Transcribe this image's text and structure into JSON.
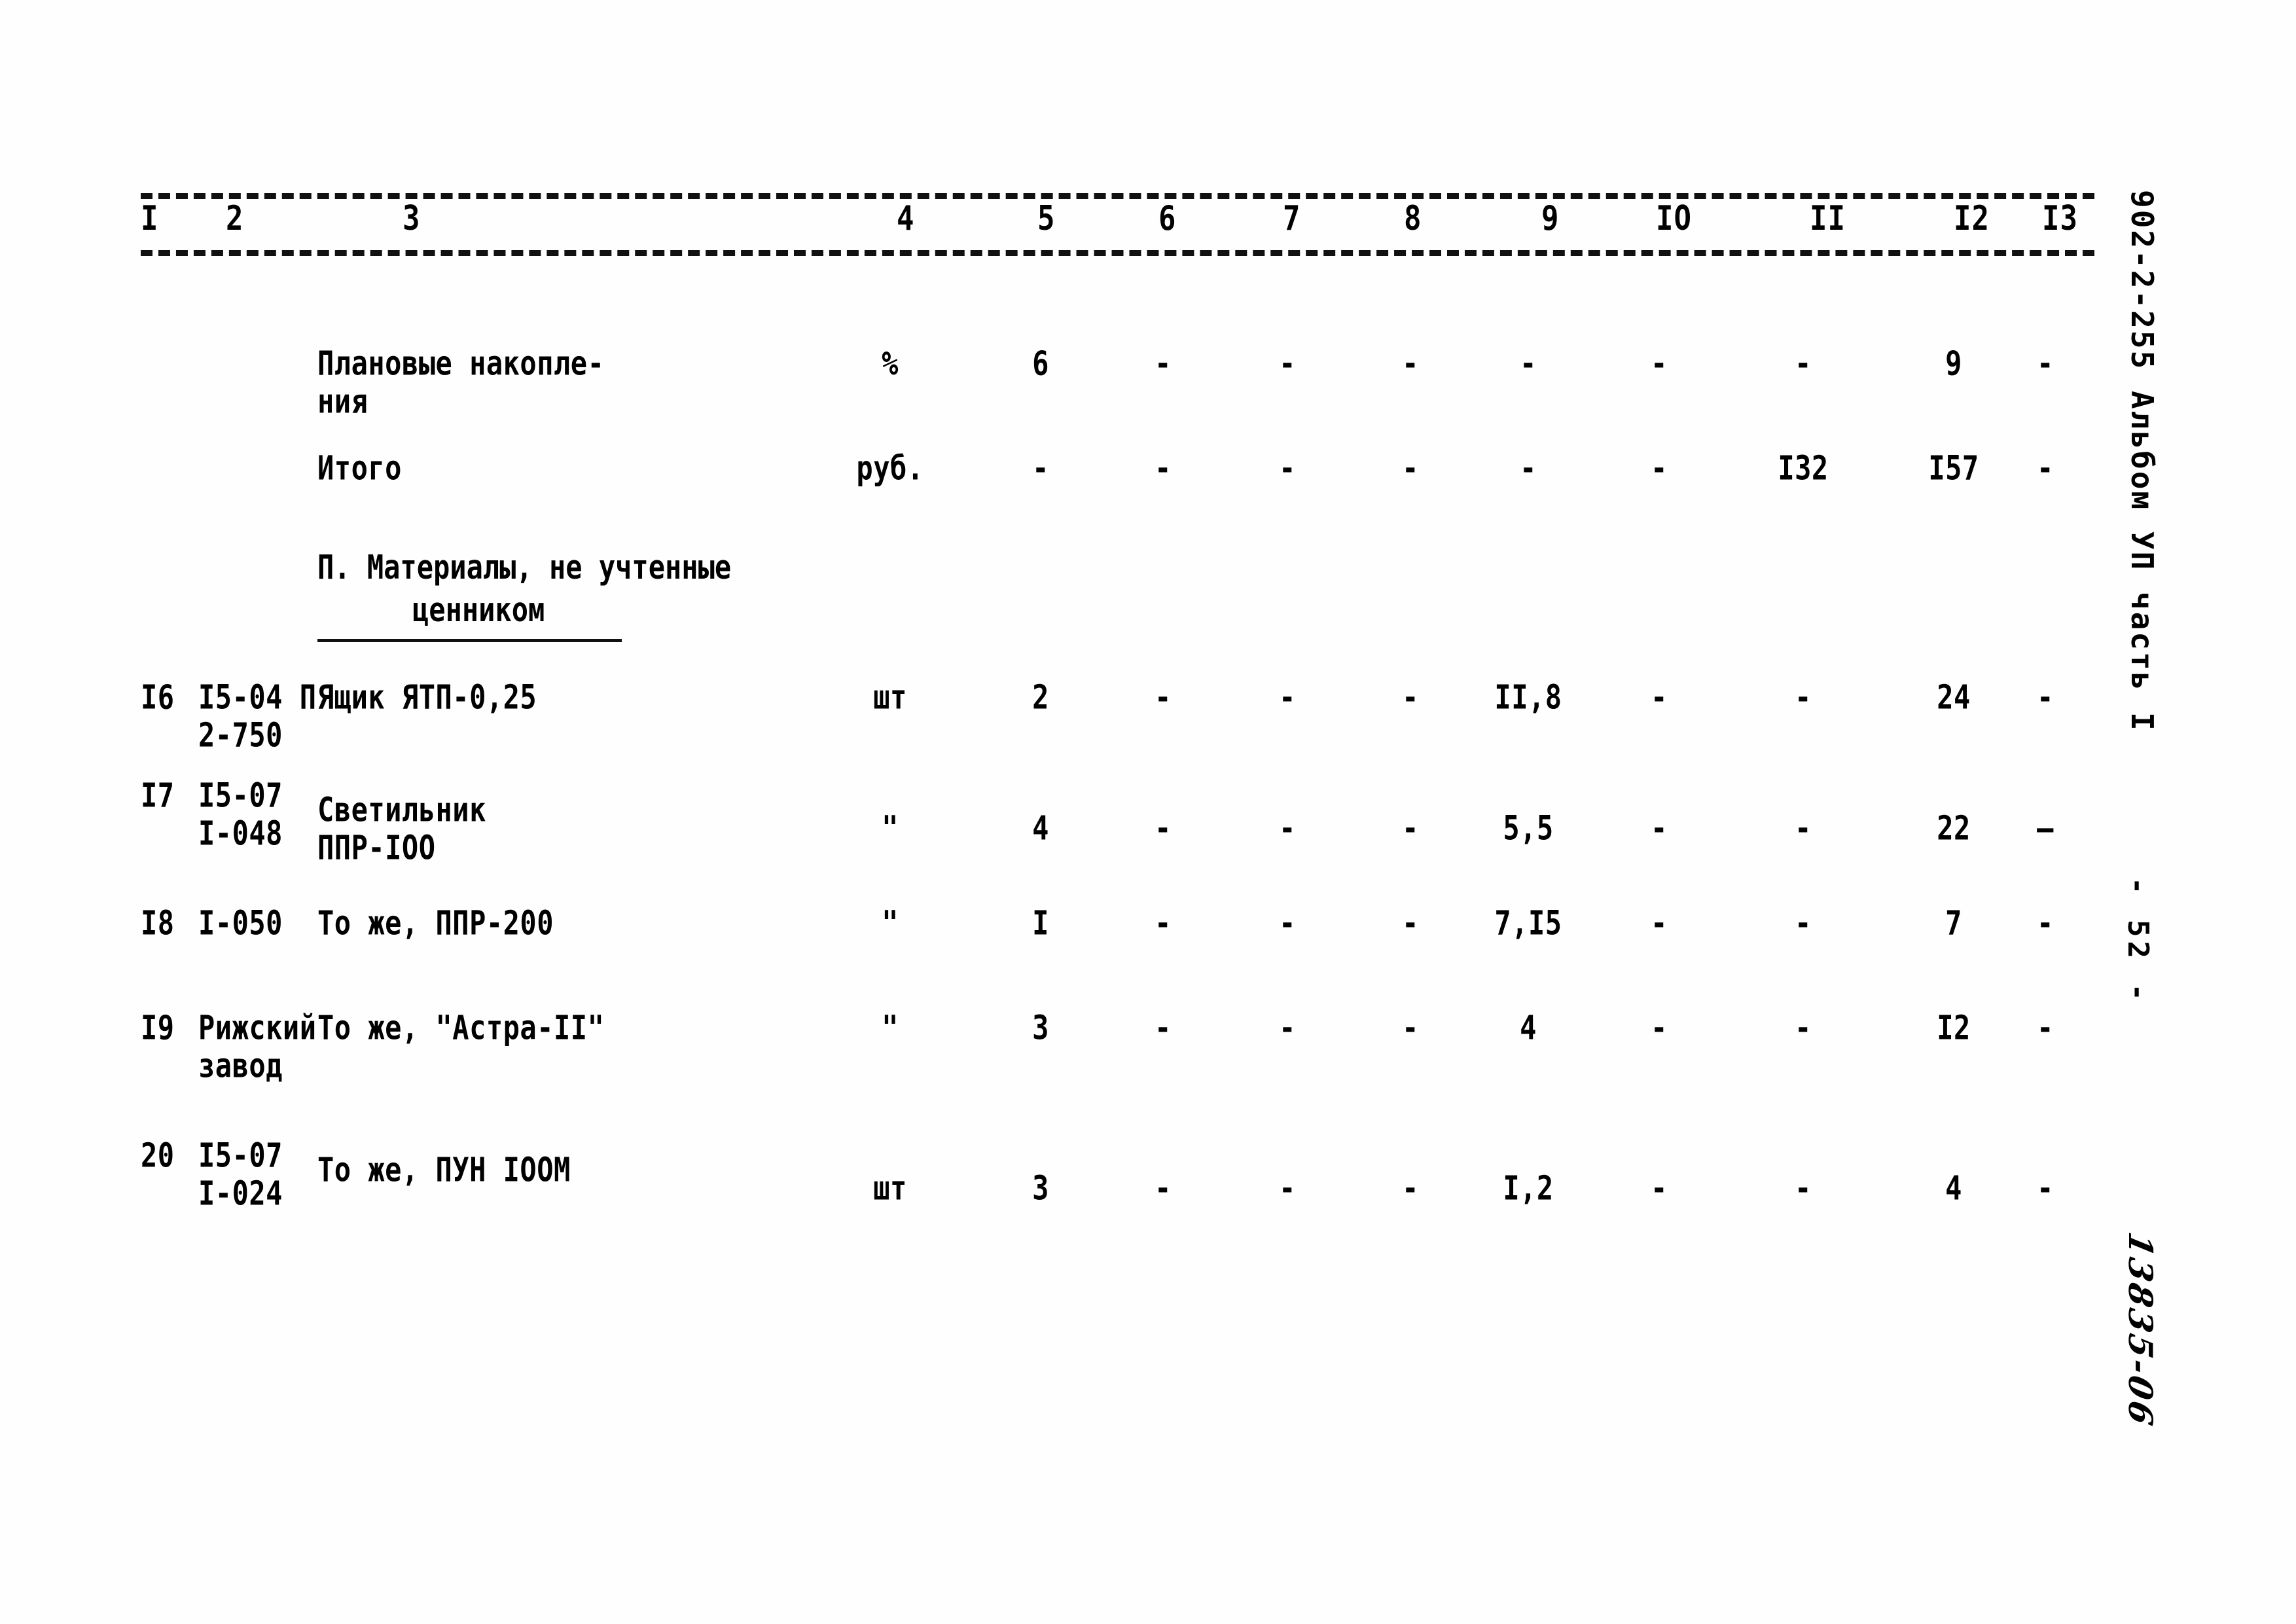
{
  "document": {
    "album_reference": "902-2-255 Альбом УП часть I",
    "page_number": "- 52 -",
    "stamp": "13835-06"
  },
  "table": {
    "column_numbers": [
      "I",
      "2",
      "3",
      "4",
      "5",
      "6",
      "7",
      "8",
      "9",
      "IO",
      "II",
      "I2",
      "I3"
    ],
    "section_heading": {
      "line1": "П. Материалы, не учтенные",
      "line2": "ценником"
    },
    "rows": [
      {
        "no": "",
        "code_line1": "",
        "code_line2": "",
        "name_line1": "Плановые накопле-",
        "name_line2": "ния",
        "unit": "%",
        "c5": "6",
        "c6": "-",
        "c7": "-",
        "c8": "-",
        "c9": "-",
        "c10": "-",
        "c11": "-",
        "c12": "9",
        "c13": "-"
      },
      {
        "no": "",
        "code_line1": "",
        "code_line2": "",
        "name_line1": "Итого",
        "name_line2": "",
        "unit": "руб.",
        "c5": "-",
        "c6": "-",
        "c7": "-",
        "c8": "-",
        "c9": "-",
        "c10": "-",
        "c11": "I32",
        "c12": "I57",
        "c13": "-"
      },
      {
        "no": "I6",
        "code_line1": "I5-04 П",
        "code_line2": "2-750",
        "name_line1": "Ящик ЯТП-0,25",
        "name_line2": "",
        "unit": "шт",
        "c5": "2",
        "c6": "-",
        "c7": "-",
        "c8": "-",
        "c9": "II,8",
        "c10": "-",
        "c11": "-",
        "c12": "24",
        "c13": "-"
      },
      {
        "no": "I7",
        "code_line1": "I5-07",
        "code_line2": "I-048",
        "name_line1": "Светильник",
        "name_line2": "ППР-IOO",
        "unit": "\"",
        "c5": "4",
        "c6": "-",
        "c7": "-",
        "c8": "-",
        "c9": "5,5",
        "c10": "-",
        "c11": "-",
        "c12": "22",
        "c13": "—"
      },
      {
        "no": "I8",
        "code_line1": "I-050",
        "code_line2": "",
        "name_line1": "То же, ППР-200",
        "name_line2": "",
        "unit": "\"",
        "c5": "I",
        "c6": "-",
        "c7": "-",
        "c8": "-",
        "c9": "7,I5",
        "c10": "-",
        "c11": "-",
        "c12": "7",
        "c13": "-"
      },
      {
        "no": "I9",
        "code_line1": "Рижский",
        "code_line2": "завод",
        "name_line1": "То же, \"Астра-II\"",
        "name_line2": "",
        "unit": "\"",
        "c5": "3",
        "c6": "-",
        "c7": "-",
        "c8": "-",
        "c9": "4",
        "c10": "-",
        "c11": "-",
        "c12": "I2",
        "c13": "-"
      },
      {
        "no": "20",
        "code_line1": "I5-07",
        "code_line2": "I-024",
        "name_line1": "То же, ПУН IOOМ",
        "name_line2": "",
        "unit": "шт",
        "c5": "3",
        "c6": "-",
        "c7": "-",
        "c8": "-",
        "c9": "I,2",
        "c10": "-",
        "c11": "-",
        "c12": "4",
        "c13": "-"
      }
    ]
  }
}
